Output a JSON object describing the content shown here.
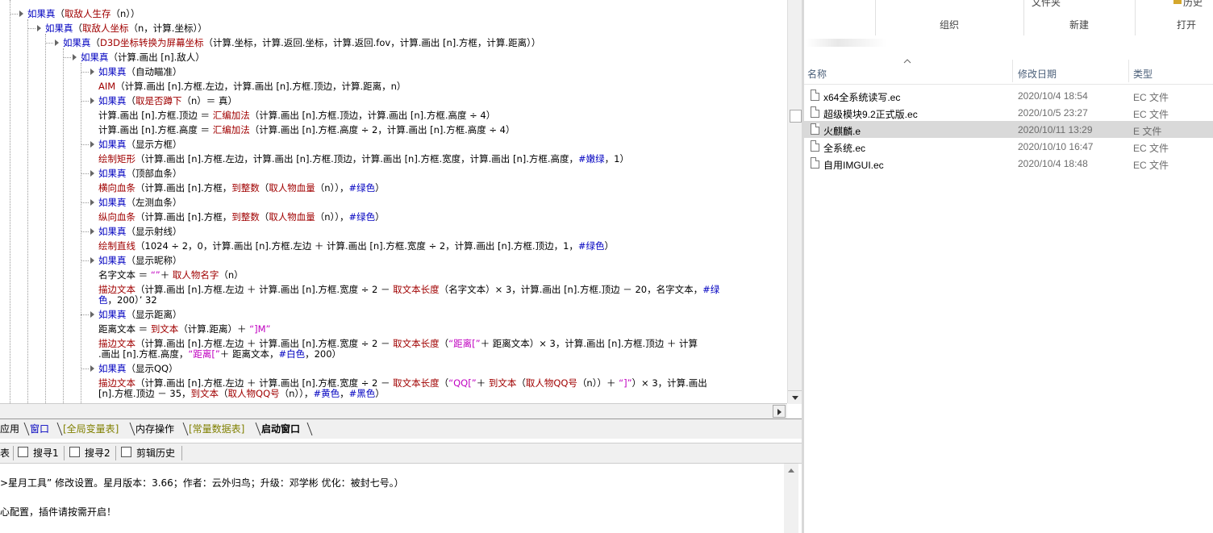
{
  "code_lines": [
    {
      "segs": [
        [
          "kw",
          "如果真"
        ],
        [
          "",
          "（"
        ],
        [
          "fn",
          "取敌人生存"
        ],
        [
          "",
          "（n））"
        ]
      ]
    },
    {
      "segs": [
        [
          "kw",
          "如果真"
        ],
        [
          "",
          "（"
        ],
        [
          "fn",
          "取敌人坐标"
        ],
        [
          "",
          "（n，计算.坐标））"
        ]
      ]
    },
    {
      "segs": [
        [
          "kw",
          "如果真"
        ],
        [
          "",
          "（"
        ],
        [
          "fn",
          "D3D坐标转换为屏幕坐标"
        ],
        [
          "",
          "（计算.坐标，计算.返回.坐标，计算.返回.fov，计算.画出 [n].方框，计算.距离））"
        ]
      ]
    },
    {
      "segs": [
        [
          "kw",
          "如果真"
        ],
        [
          "",
          "（计算.画出 [n].敌人）"
        ]
      ]
    },
    {
      "segs": [
        [
          "kw",
          "如果真"
        ],
        [
          "",
          "（自动瞄准）"
        ]
      ]
    },
    {
      "segs": [
        [
          "fn",
          "AIM"
        ],
        [
          "",
          "（计算.画出 [n].方框.左边，计算.画出 [n].方框.顶边，计算.距离，n）"
        ]
      ]
    },
    {
      "segs": [
        [
          "kw",
          "如果真"
        ],
        [
          "",
          "（"
        ],
        [
          "fn",
          "取是否蹲下"
        ],
        [
          "",
          "（n）＝ 真）"
        ]
      ]
    },
    {
      "segs": [
        [
          "",
          "计算.画出 [n].方框.顶边 ＝ "
        ],
        [
          "fn",
          "汇编加法"
        ],
        [
          "",
          "（计算.画出 [n].方框.顶边，计算.画出 [n].方框.高度 ÷ 4）"
        ]
      ]
    },
    {
      "segs": [
        [
          "",
          "计算.画出 [n].方框.高度 ＝ "
        ],
        [
          "fn",
          "汇编加法"
        ],
        [
          "",
          "（计算.画出 [n].方框.高度 ÷ 2，计算.画出 [n].方框.高度 ÷ 4）"
        ]
      ]
    },
    {
      "segs": [
        [
          "kw",
          "如果真"
        ],
        [
          "",
          "（显示方框）"
        ]
      ]
    },
    {
      "segs": [
        [
          "fn",
          "绘制矩形"
        ],
        [
          "",
          "（计算.画出 [n].方框.左边，计算.画出 [n].方框.顶边，计算.画出 [n].方框.宽度，计算.画出 [n].方框.高度，"
        ],
        [
          "cst",
          "#嫩绿"
        ],
        [
          "",
          "，1）"
        ]
      ]
    },
    {
      "segs": [
        [
          "kw",
          "如果真"
        ],
        [
          "",
          "（顶部血条）"
        ]
      ]
    },
    {
      "segs": [
        [
          "fn",
          "横向血条"
        ],
        [
          "",
          "（计算.画出 [n].方框，"
        ],
        [
          "fn",
          "到整数"
        ],
        [
          "",
          "（"
        ],
        [
          "fn",
          "取人物血量"
        ],
        [
          "",
          "（n）），"
        ],
        [
          "cst",
          "#绿色"
        ],
        [
          "",
          "）"
        ]
      ]
    },
    {
      "segs": [
        [
          "kw",
          "如果真"
        ],
        [
          "",
          "（左测血条）"
        ]
      ]
    },
    {
      "segs": [
        [
          "fn",
          "纵向血条"
        ],
        [
          "",
          "（计算.画出 [n].方框，"
        ],
        [
          "fn",
          "到整数"
        ],
        [
          "",
          "（"
        ],
        [
          "fn",
          "取人物血量"
        ],
        [
          "",
          "（n）），"
        ],
        [
          "cst",
          "#绿色"
        ],
        [
          "",
          "）"
        ]
      ]
    },
    {
      "segs": [
        [
          "kw",
          "如果真"
        ],
        [
          "",
          "（显示射线）"
        ]
      ]
    },
    {
      "segs": [
        [
          "fn",
          "绘制直线"
        ],
        [
          "",
          "（1024 ÷ 2，0，计算.画出 [n].方框.左边 ＋ 计算.画出 [n].方框.宽度 ÷ 2，计算.画出 [n].方框.顶边，1，"
        ],
        [
          "cst",
          "#绿色"
        ],
        [
          "",
          "）"
        ]
      ]
    },
    {
      "segs": [
        [
          "kw",
          "如果真"
        ],
        [
          "",
          "（显示昵称）"
        ]
      ]
    },
    {
      "segs": [
        [
          "",
          "名字文本 ＝ "
        ],
        [
          "str",
          "“”"
        ],
        [
          "",
          "＋ "
        ],
        [
          "fn",
          "取人物名字"
        ],
        [
          "",
          "（n）"
        ]
      ]
    },
    {
      "segs": [
        [
          "fn",
          "描边文本"
        ],
        [
          "",
          "（计算.画出 [n].方框.左边 ＋ 计算.画出 [n].方框.宽度 ÷ 2 － "
        ],
        [
          "fn",
          "取文本长度"
        ],
        [
          "",
          "（名字文本）× 3，计算.画出 [n].方框.顶边 － 20，名字文本，"
        ],
        [
          "cst",
          "#绿"
        ]
      ]
    },
    {
      "segs": [
        [
          "cst",
          "色"
        ],
        [
          "",
          "，200）’ 32"
        ]
      ]
    },
    {
      "segs": [
        [
          "kw",
          "如果真"
        ],
        [
          "",
          "（显示距离）"
        ]
      ]
    },
    {
      "segs": [
        [
          "",
          "距离文本 ＝ "
        ],
        [
          "fn",
          "到文本"
        ],
        [
          "",
          "（计算.距离）＋ "
        ],
        [
          "str",
          "“]M”"
        ]
      ]
    },
    {
      "segs": [
        [
          "fn",
          "描边文本"
        ],
        [
          "",
          "（计算.画出 [n].方框.左边 ＋ 计算.画出 [n].方框.宽度 ÷ 2 － "
        ],
        [
          "fn",
          "取文本长度"
        ],
        [
          "",
          "（"
        ],
        [
          "str",
          "“距离[”"
        ],
        [
          "",
          "＋ 距离文本）× 3，计算.画出 [n].方框.顶边 ＋ 计算"
        ]
      ]
    },
    {
      "segs": [
        [
          "",
          ".画出 [n].方框.高度，"
        ],
        [
          "str",
          "“距离[”"
        ],
        [
          "",
          "＋ 距离文本，"
        ],
        [
          "cst",
          "#白色"
        ],
        [
          "",
          "，200）"
        ]
      ]
    },
    {
      "segs": [
        [
          "kw",
          "如果真"
        ],
        [
          "",
          "（显示QQ）"
        ]
      ]
    },
    {
      "segs": [
        [
          "fn",
          "描边文本"
        ],
        [
          "",
          "（计算.画出 [n].方框.左边 ＋ 计算.画出 [n].方框.宽度 ÷ 2 － "
        ],
        [
          "fn",
          "取文本长度"
        ],
        [
          "",
          "（"
        ],
        [
          "str",
          "“QQ[”"
        ],
        [
          "",
          "＋ "
        ],
        [
          "fn",
          "到文本"
        ],
        [
          "",
          "（"
        ],
        [
          "fn",
          "取人物QQ号"
        ],
        [
          "",
          "（n））＋ "
        ],
        [
          "str",
          "“]”"
        ],
        [
          "",
          "）× 3，计算.画出"
        ]
      ]
    },
    {
      "segs": [
        [
          "",
          "[n].方框.顶边 － 35，"
        ],
        [
          "fn",
          "到文本"
        ],
        [
          "",
          "（"
        ],
        [
          "fn",
          "取人物QQ号"
        ],
        [
          "",
          "（n）），"
        ],
        [
          "cst",
          "#黄色"
        ],
        [
          "",
          "，"
        ],
        [
          "cst",
          "#黑色"
        ],
        [
          "",
          "）"
        ]
      ]
    }
  ],
  "tabs": [
    {
      "label": "应用",
      "style": "normal"
    },
    {
      "label": "窗口",
      "style": "blue"
    },
    {
      "label": "[全局变量表]",
      "style": "olive"
    },
    {
      "label": "内存操作",
      "style": "normal"
    },
    {
      "label": "[常量数据表]",
      "style": "olive"
    },
    {
      "label": "启动窗口",
      "style": "bold"
    }
  ],
  "toolbar": {
    "t0": "表",
    "t1": "搜寻1",
    "t2": "搜寻2",
    "t3": "剪辑历史"
  },
  "output": {
    "line1": ">星月工具” 修改设置。星月版本：3.66；作者：云外归鸟；升级：邓学彬 优化：被封七号。）",
    "line2": "心配置，插件请按需开启！"
  },
  "explorer": {
    "ribbon_groups": {
      "organize": "组织",
      "new": "新建",
      "open": "打开"
    },
    "ribbon_partial": {
      "new_top": "文件夹",
      "open_top": "历史"
    },
    "columns": {
      "name": "名称",
      "date": "修改日期",
      "type": "类型"
    },
    "files": [
      {
        "name": "x64全系统读写.ec",
        "date": "2020/10/4 18:54",
        "type": "EC 文件",
        "selected": false
      },
      {
        "name": "超级模块9.2正式版.ec",
        "date": "2020/10/5 23:27",
        "type": "EC 文件",
        "selected": false
      },
      {
        "name": "火麒麟.e",
        "date": "2020/10/11 13:29",
        "type": "E 文件",
        "selected": true
      },
      {
        "name": "全系统.ec",
        "date": "2020/10/10 16:47",
        "type": "EC 文件",
        "selected": false
      },
      {
        "name": "自用IMGUI.ec",
        "date": "2020/10/4 18:48",
        "type": "EC 文件",
        "selected": false
      }
    ]
  },
  "colors": {
    "keyword": "#0000c0",
    "function": "#a00000",
    "string": "#c000c0",
    "selected_row": "#d9d9d9"
  }
}
